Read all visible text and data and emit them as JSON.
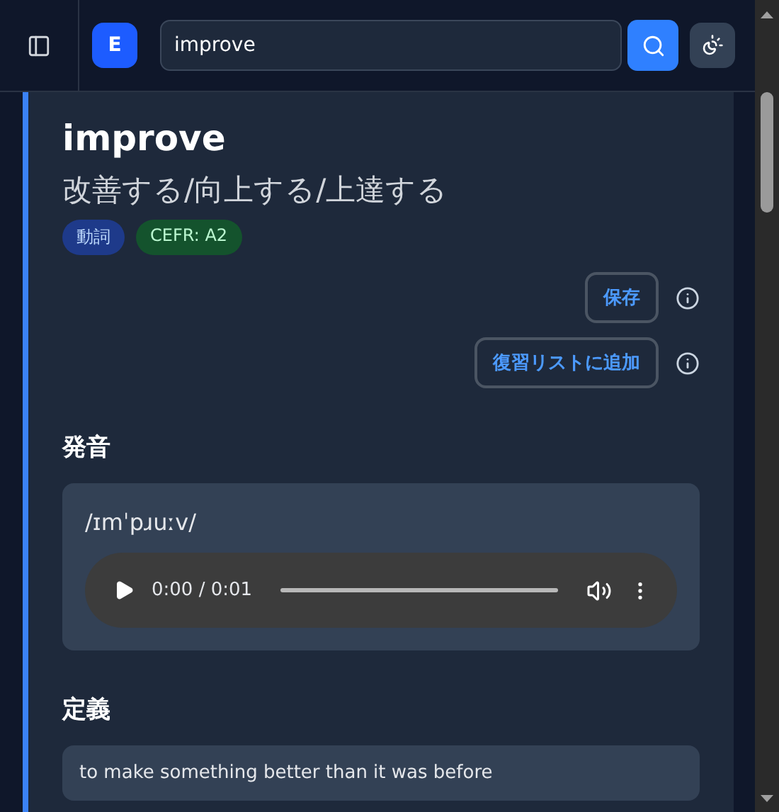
{
  "header": {
    "logo": "E",
    "search": {
      "value": "improve"
    }
  },
  "entry": {
    "word": "improve",
    "translation": "改善する/向上する/上達する",
    "tags": [
      {
        "label": "動詞",
        "kind": "pos"
      },
      {
        "label": "CEFR: A2",
        "kind": "level"
      }
    ],
    "actions": [
      {
        "label": "保存"
      },
      {
        "label": "復習リストに追加"
      }
    ],
    "pronunciation": {
      "heading": "発音",
      "ipa": "/ɪmˈpɹuːv/",
      "audio": {
        "time": "0:00 / 0:01"
      }
    },
    "definition": {
      "heading": "定義",
      "text": "to make something better than it was before"
    }
  }
}
